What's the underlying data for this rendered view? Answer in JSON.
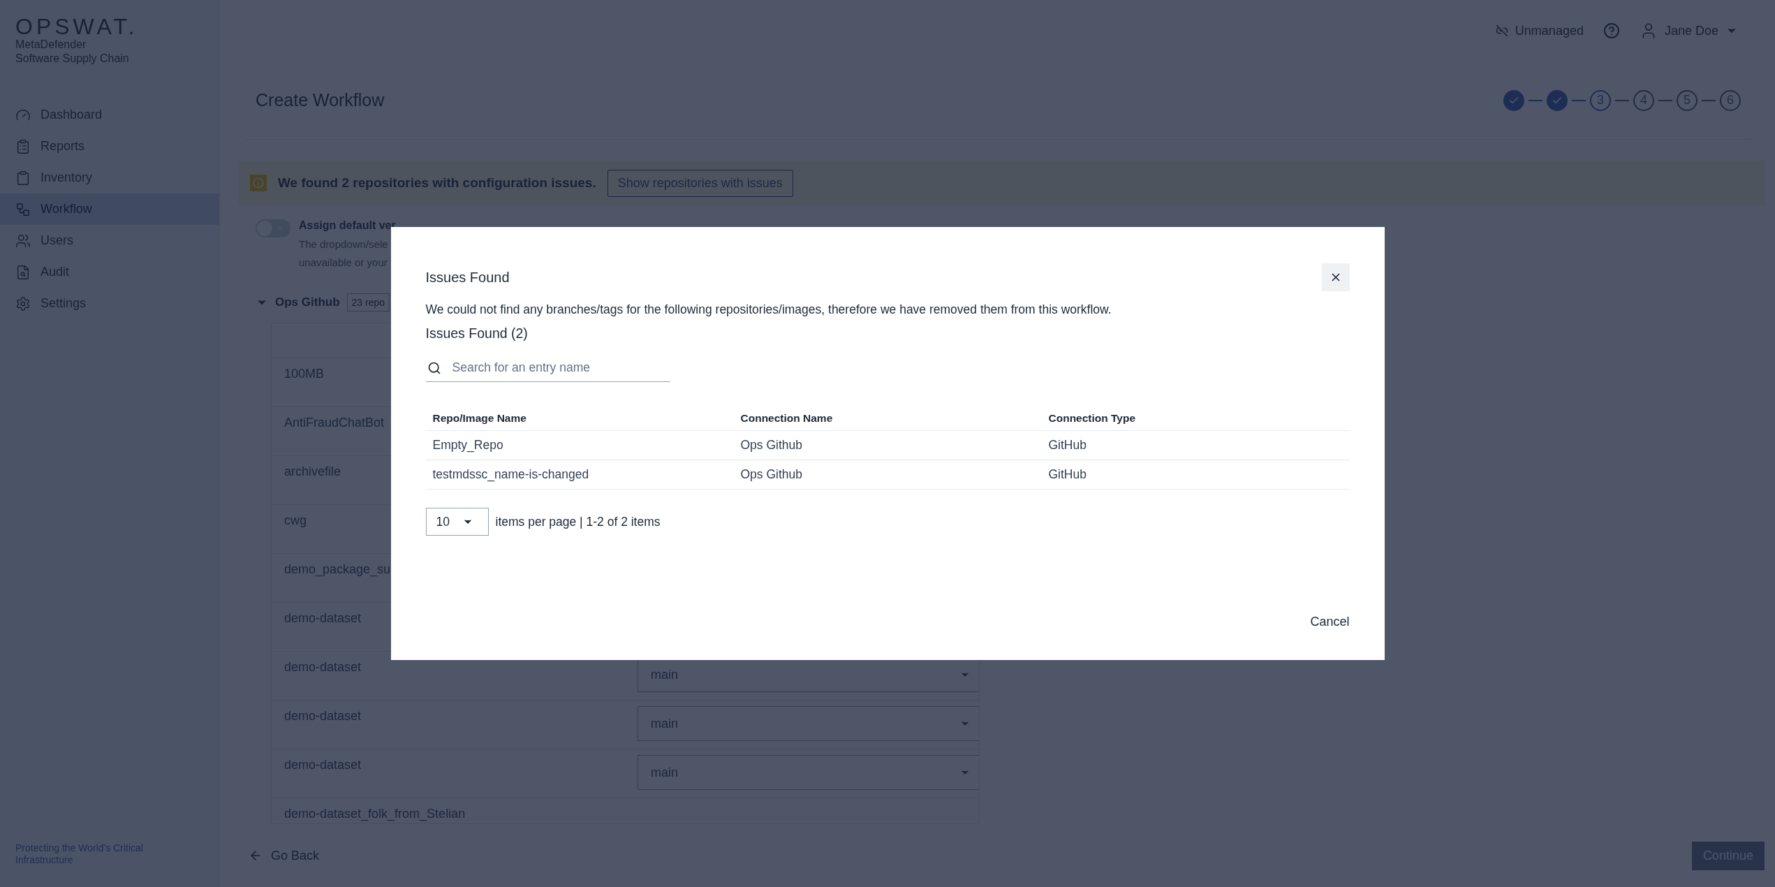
{
  "brand": {
    "logo": "OPSWAT.",
    "product_line_1": "MetaDefender",
    "product_line_2": "Software Supply Chain"
  },
  "sidebar": {
    "items": [
      {
        "label": "Dashboard",
        "selected": false
      },
      {
        "label": "Reports",
        "selected": false
      },
      {
        "label": "Inventory",
        "selected": false
      },
      {
        "label": "Workflow",
        "selected": true
      },
      {
        "label": "Users",
        "selected": false
      },
      {
        "label": "Audit",
        "selected": false
      },
      {
        "label": "Settings",
        "selected": false
      }
    ],
    "footer": "Protecting the World's Critical Infrastructure"
  },
  "header": {
    "status": "Unmanaged",
    "user": "Jane Doe"
  },
  "page": {
    "title": "Create Workflow",
    "steps": [
      {
        "done": true,
        "selected": false
      },
      {
        "done": true,
        "selected": false
      },
      {
        "label": "3",
        "done": false,
        "selected": true
      },
      {
        "label": "4",
        "done": false,
        "selected": false
      },
      {
        "label": "5",
        "done": false,
        "selected": false
      },
      {
        "label": "6",
        "done": false,
        "selected": false
      }
    ],
    "banner": {
      "message": "We found 2 repositories with configuration issues.",
      "button": "Show repositories with issues"
    },
    "toggle": {
      "on": false,
      "label": "Assign default ver",
      "help_line_1": "The dropdown/sele",
      "help_line_2": "unavailable or your"
    },
    "group": {
      "name": "Ops Github",
      "count": "23 repo",
      "expanded": true
    },
    "rows": [
      {
        "name": "100MB"
      },
      {
        "name": "AntiFraudChatBot"
      },
      {
        "name": "archivefile"
      },
      {
        "name": "cwg"
      },
      {
        "name": "demo_package_su"
      },
      {
        "name": "demo-dataset"
      },
      {
        "name": "demo-dataset",
        "branch": "main"
      },
      {
        "name": "demo-dataset",
        "branch": "main"
      },
      {
        "name": "demo-dataset",
        "branch": "main"
      },
      {
        "name": "demo-dataset_folk_from_Stelian"
      }
    ],
    "back": "Go Back",
    "continue": {
      "label": "Continue",
      "disabled": true
    }
  },
  "dialog": {
    "title": "Issues Found",
    "description": "We could not find any branches/tags for the following repositories/images, therefore we have removed them from this workflow.",
    "subtitle": "Issues Found (2)",
    "search": {
      "placeholder": "Search for an entry name"
    },
    "table": {
      "columns": [
        "Repo/Image Name",
        "Connection Name",
        "Connection Type"
      ],
      "rows": [
        [
          "Empty_Repo",
          "Ops Github",
          "GitHub"
        ],
        [
          "testmdssc_name-is-changed",
          "Ops Github",
          "GitHub"
        ]
      ]
    },
    "pagination": {
      "page_size": "10",
      "summary": "items per page | 1-2 of 2 items"
    },
    "cancel": "Cancel"
  }
}
